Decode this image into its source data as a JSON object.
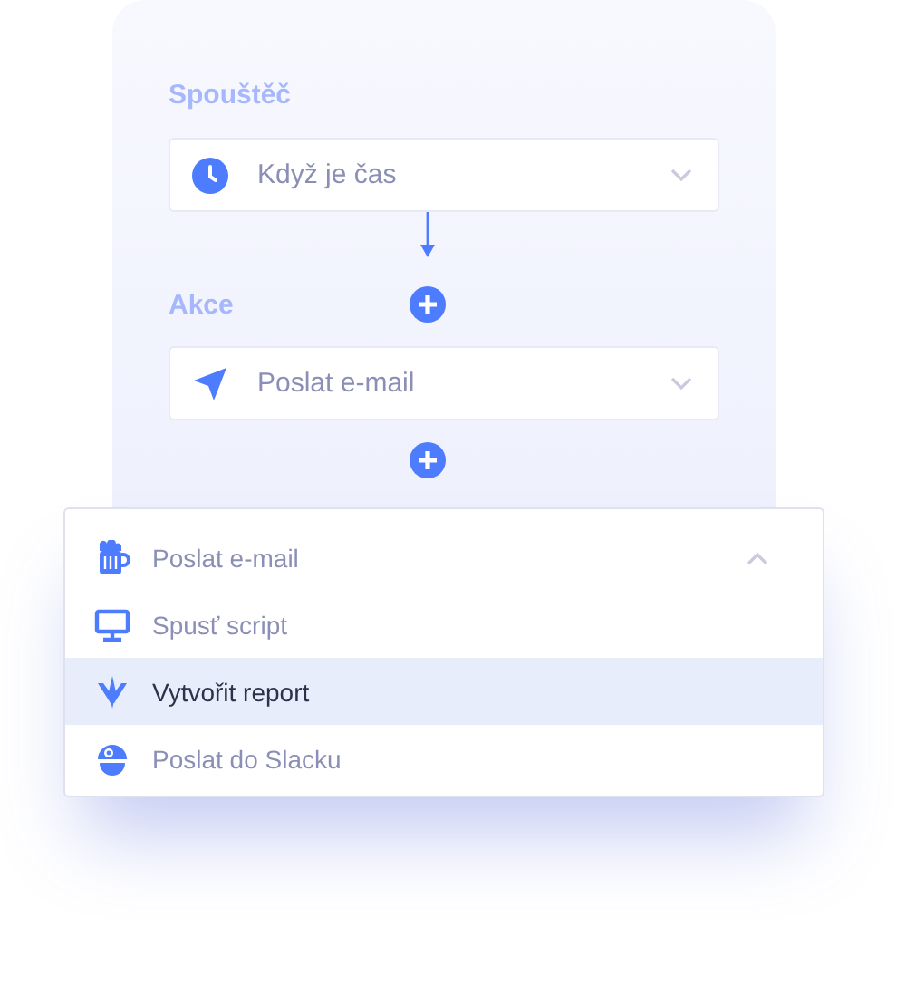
{
  "trigger": {
    "label": "Spouštěč",
    "select": {
      "value": "Když je čas"
    }
  },
  "action": {
    "label": "Akce",
    "select": {
      "value": "Poslat e-mail"
    }
  },
  "menu": {
    "expanded": true,
    "items": [
      {
        "label": "Poslat e-mail",
        "selected": false
      },
      {
        "label": "Spusť script",
        "selected": false
      },
      {
        "label": "Vytvořit report",
        "selected": true
      },
      {
        "label": "Poslat do Slacku",
        "selected": false
      }
    ]
  }
}
